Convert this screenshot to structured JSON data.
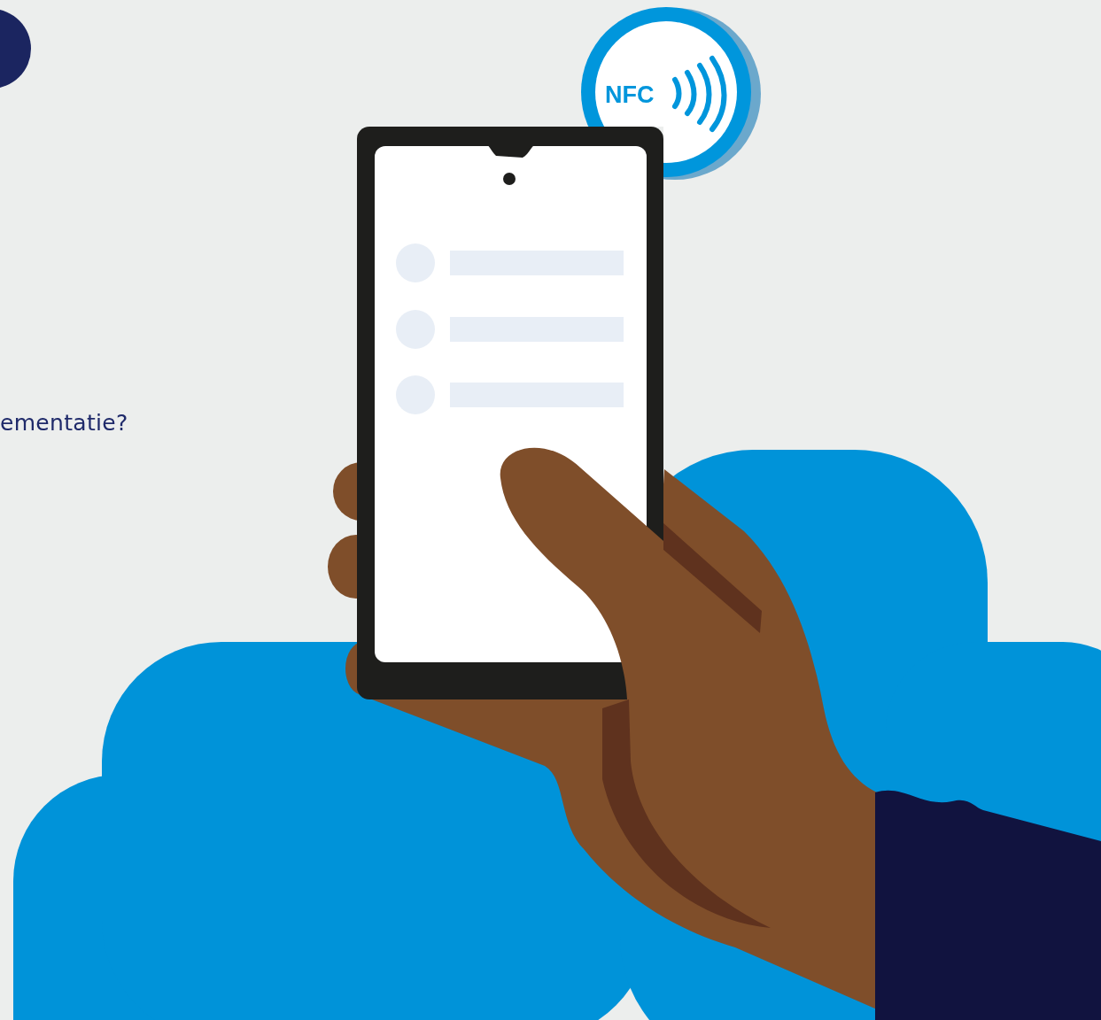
{
  "question": {
    "text": "ementatie?"
  },
  "badge": {
    "label": "NFC"
  }
}
